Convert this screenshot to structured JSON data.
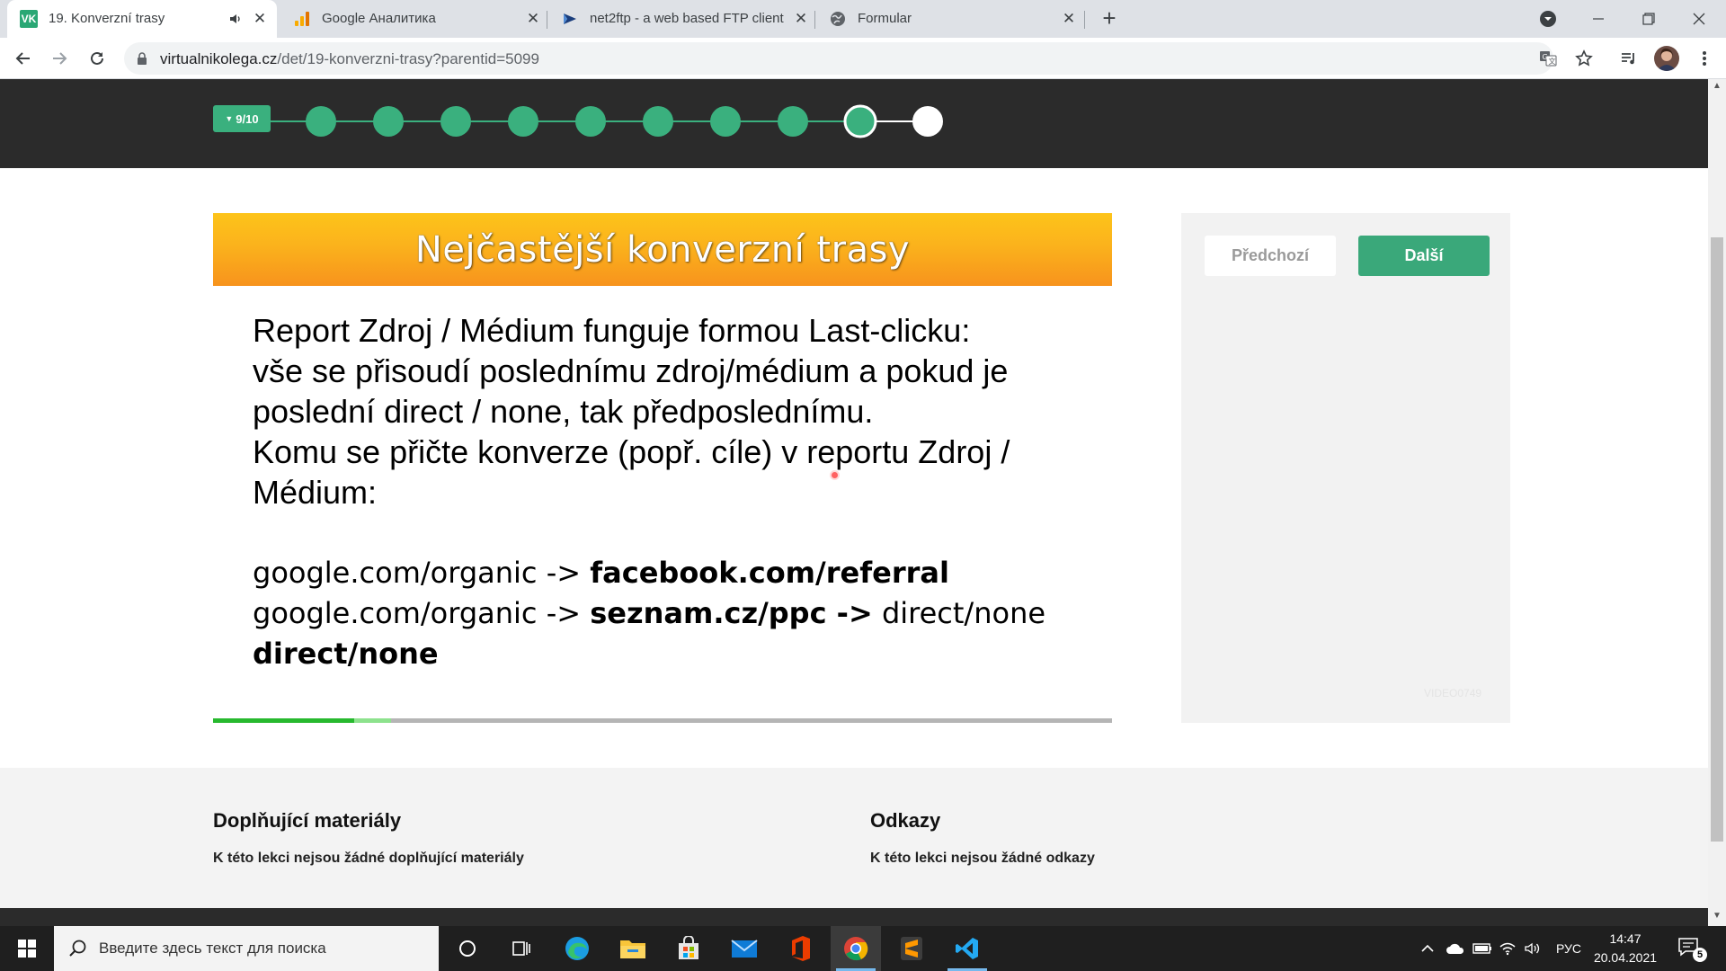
{
  "browser": {
    "tabs": [
      {
        "title": "19. Konverzní trasy",
        "favicon_text": "VK",
        "active": true
      },
      {
        "title": "Google Аналитика",
        "favicon": "analytics-icon"
      },
      {
        "title": "net2ftp - a web based FTP client",
        "favicon": "net2ftp-icon"
      },
      {
        "title": "Formular",
        "favicon": "globe-icon"
      }
    ],
    "url_host": "virtualnikolega.cz",
    "url_path": "/det/19-konverzni-trasy?parentid=5099"
  },
  "lesson_progress": {
    "label": "9/10",
    "current": 9,
    "total": 10
  },
  "slide": {
    "title": "Nejčastější konverzní trasy",
    "paragraph_lines": [
      "Report Zdroj / Médium funguje formou Last-clicku:",
      "vše se přisoudí poslednímu zdroj/médium a pokud je",
      "poslední direct / none, tak předposlednímu.",
      "Komu se přičte konverze (popř. cíle) v reportu Zdroj /",
      "Médium:"
    ],
    "path1_plain": "google.com/organic -> ",
    "path1_bold": "facebook.com/referral",
    "path2_plain": "google.com/organic -> ",
    "path2_bold": "seznam.cz/ppc ->",
    "path2_tail": " direct/none",
    "path3_bold": "direct/none",
    "video_played_fraction": 0.157,
    "video_buffered_fraction": 0.198
  },
  "side_panel": {
    "prev_label": "Předchozí",
    "next_label": "Další",
    "video_id": "VIDEO0749"
  },
  "materials": {
    "extra_title": "Doplňující materiály",
    "extra_text": "K této lekci nejsou žádné doplňující materiály",
    "links_title": "Odkazy",
    "links_text": "K této lekci nejsou žádné odkazy"
  },
  "taskbar": {
    "search_placeholder": "Введите здесь текст для поиска",
    "lang": "РУС",
    "time": "14:47",
    "date": "20.04.2021",
    "notifications": "5"
  }
}
